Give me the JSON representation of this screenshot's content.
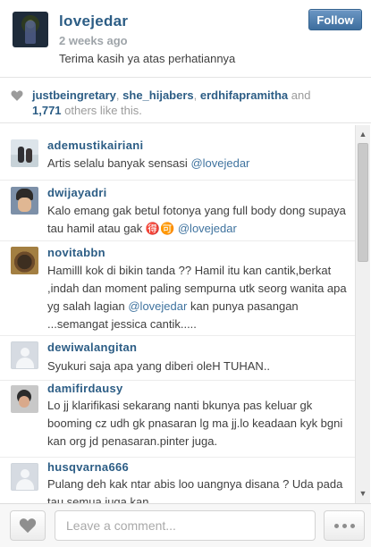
{
  "post": {
    "username": "lovejedar",
    "timestamp": "2 weeks ago",
    "caption": "Terima kasih ya atas perhatiannya",
    "follow_label": "Follow"
  },
  "likes": {
    "users": [
      "justbeingretary",
      "she_hijabers",
      "erdhifapramitha"
    ],
    "and_label": "and",
    "others_count": "1,771",
    "others_suffix": "others like this."
  },
  "comments": [
    {
      "username": "ademustikairiani",
      "text": "Artis selalu banyak sensasi",
      "mention": "@lovejedar",
      "after": ""
    },
    {
      "username": "dwijayadri",
      "text": "Kalo emang gak betul fotonya yang full body dong supaya tau hamil atau gak 🉐🉑",
      "mention": "@lovejedar",
      "after": ""
    },
    {
      "username": "novitabbn",
      "text": "Hamilll kok di bikin tanda ?? Hamil itu kan cantik,berkat ,indah dan moment paling sempurna utk seorg wanita apa yg salah lagian",
      "mention": "@lovejedar",
      "after": "kan punya pasangan ...semangat jessica cantik....."
    },
    {
      "username": "dewiwalangitan",
      "text": "Syukuri saja apa yang diberi oleH TUHAN..",
      "mention": "",
      "after": ""
    },
    {
      "username": "damifirdausy",
      "text": "Lo jj klarifikasi sekarang nanti bkunya pas keluar gk booming cz udh gk pnasaran lg ma jj.lo keadaan kyk bgni kan org jd penasaran.pinter juga.",
      "mention": "",
      "after": ""
    },
    {
      "username": "husqvarna666",
      "text": "Pulang deh kak ntar abis loo uangnya disana ? Uda pada tau semua juga kan",
      "mention": "",
      "after": ""
    }
  ],
  "footer": {
    "comment_placeholder": "Leave a comment..."
  }
}
